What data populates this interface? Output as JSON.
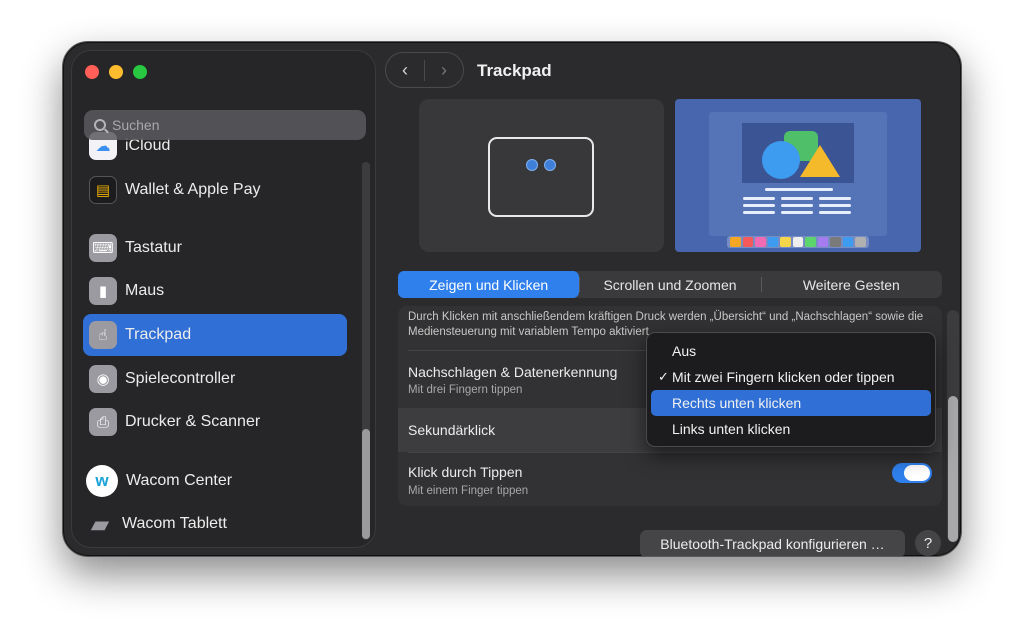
{
  "window": {
    "title": "Trackpad"
  },
  "toolbar": {
    "back": "‹",
    "forward": "›"
  },
  "search": {
    "placeholder": "Suchen"
  },
  "sidebar": {
    "items": [
      {
        "label": "iCloud",
        "icon": "icloud-icon",
        "glyph": "☁"
      },
      {
        "label": "Wallet & Apple Pay",
        "icon": "wallet-icon",
        "glyph": "▤"
      },
      {
        "label": "Tastatur",
        "icon": "keyboard-icon",
        "glyph": "⌨"
      },
      {
        "label": "Maus",
        "icon": "mouse-icon",
        "glyph": "▮"
      },
      {
        "label": "Trackpad",
        "icon": "trackpad-icon",
        "glyph": "☝",
        "active": true
      },
      {
        "label": "Spielecontroller",
        "icon": "gamecontroller-icon",
        "glyph": "◉"
      },
      {
        "label": "Drucker & Scanner",
        "icon": "printer-icon",
        "glyph": "⎙"
      },
      {
        "label": "Wacom Center",
        "icon": "wacom-icon",
        "glyph": "w"
      },
      {
        "label": "Wacom Tablett",
        "icon": "tablet-icon",
        "glyph": "▰"
      }
    ]
  },
  "tabs": [
    {
      "label": "Zeigen und Klicken",
      "active": true
    },
    {
      "label": "Scrollen und Zoomen"
    },
    {
      "label": "Weitere Gesten"
    }
  ],
  "settings": {
    "description": "Durch Klicken mit anschließendem kräftigen Druck werden „Übersicht“ und „Nachschlagen“ sowie die Mediensteuerung mit variablem Tempo aktiviert.",
    "lookup": {
      "title": "Nachschlagen & Datenerkennung",
      "subtitle": "Mit drei Fingern tippen"
    },
    "secondary_click": {
      "title": "Sekundärklick"
    },
    "tap_to_click": {
      "title": "Klick durch Tippen",
      "subtitle": "Mit einem Finger tippen",
      "enabled": true
    }
  },
  "menu": {
    "items": [
      {
        "label": "Aus"
      },
      {
        "label": "Mit zwei Fingern klicken oder tippen",
        "checked": true,
        "check": "✓"
      },
      {
        "label": "Rechts unten klicken",
        "highlighted": true
      },
      {
        "label": "Links unten klicken"
      }
    ]
  },
  "footer": {
    "bluetooth_button": "Bluetooth-Trackpad konfigurieren …",
    "help": "?"
  },
  "colors": {
    "accent": "#2f80ed",
    "window": "#2b2b2d",
    "sidebar_active": "#2f6fd6"
  }
}
